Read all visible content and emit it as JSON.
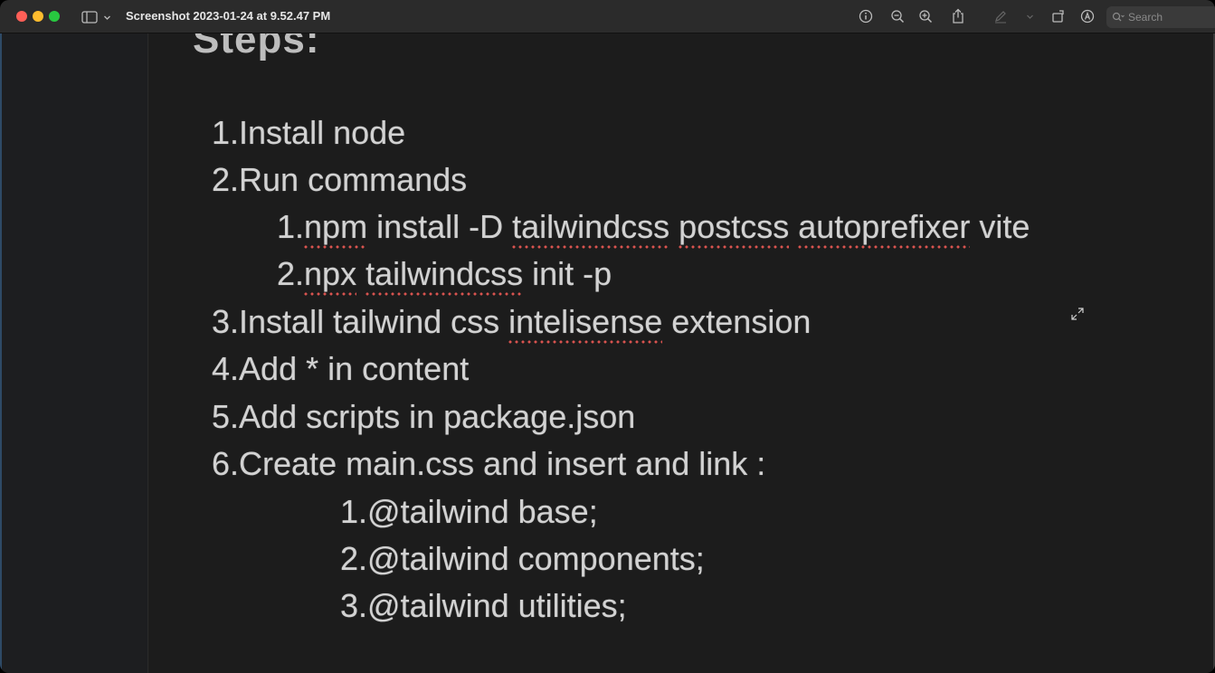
{
  "window": {
    "title": "Screenshot 2023-01-24 at 9.52.47 PM"
  },
  "toolbar": {
    "search_placeholder": "Search",
    "icons": [
      "info-icon",
      "zoom-out-icon",
      "zoom-in-icon",
      "share-icon",
      "markup-pen-icon",
      "chevron-down-icon",
      "rotate-icon",
      "annotate-icon",
      "search-icon"
    ]
  },
  "document": {
    "heading": "Steps:",
    "items": [
      {
        "n": "1.",
        "parts": [
          {
            "t": "Install node"
          }
        ]
      },
      {
        "n": "2.",
        "parts": [
          {
            "t": "Run commands"
          }
        ]
      },
      {
        "n": "1.",
        "parts": [
          {
            "t": "npm",
            "s": true
          },
          {
            "t": " install -D "
          },
          {
            "t": "tailwindcss",
            "s": true
          },
          {
            "t": " "
          },
          {
            "t": "postcss",
            "s": true
          },
          {
            "t": " "
          },
          {
            "t": "autoprefixer",
            "s": true
          },
          {
            "t": " vite"
          }
        ]
      },
      {
        "n": "2.",
        "parts": [
          {
            "t": "npx",
            "s": true
          },
          {
            "t": " "
          },
          {
            "t": "tailwindcss",
            "s": true
          },
          {
            "t": " init -p"
          }
        ]
      },
      {
        "n": "3.",
        "parts": [
          {
            "t": "Install tailwind css "
          },
          {
            "t": "intelisense",
            "s": true
          },
          {
            "t": " extension"
          }
        ]
      },
      {
        "n": "4.",
        "parts": [
          {
            "t": "Add * in content"
          }
        ]
      },
      {
        "n": "5.",
        "parts": [
          {
            "t": "Add scripts in package.json"
          }
        ]
      },
      {
        "n": "6.",
        "parts": [
          {
            "t": "Create main.css and insert and link :"
          }
        ]
      },
      {
        "n": "1.",
        "parts": [
          {
            "t": "@tailwind base;"
          }
        ]
      },
      {
        "n": "2.",
        "parts": [
          {
            "t": "@tailwind components;"
          }
        ]
      },
      {
        "n": "3.",
        "parts": [
          {
            "t": "@tailwind utilities;"
          }
        ]
      }
    ]
  },
  "colors": {
    "traffic_close": "#ff5f57",
    "traffic_minimize": "#febc2e",
    "traffic_maximize": "#28c840",
    "spellcheck_underline": "#d9534f"
  }
}
